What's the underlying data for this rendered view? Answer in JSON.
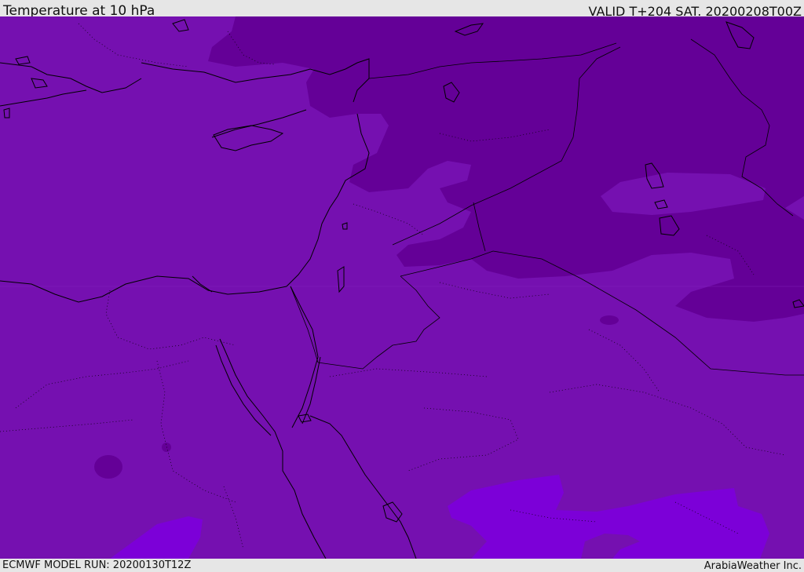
{
  "header": {
    "title": "Temperature at 10 hPa",
    "valid": "VALID T+204 SAT. 20200208T00Z"
  },
  "footer": {
    "model_run": "ECMWF MODEL RUN: 20200130T12Z",
    "provider": "ArabiaWeather Inc."
  },
  "colors": {
    "base_fill": "#7510b0",
    "cold_fill": "#640097",
    "warm_fill": "#7c00d8",
    "coastline": "#000000"
  }
}
